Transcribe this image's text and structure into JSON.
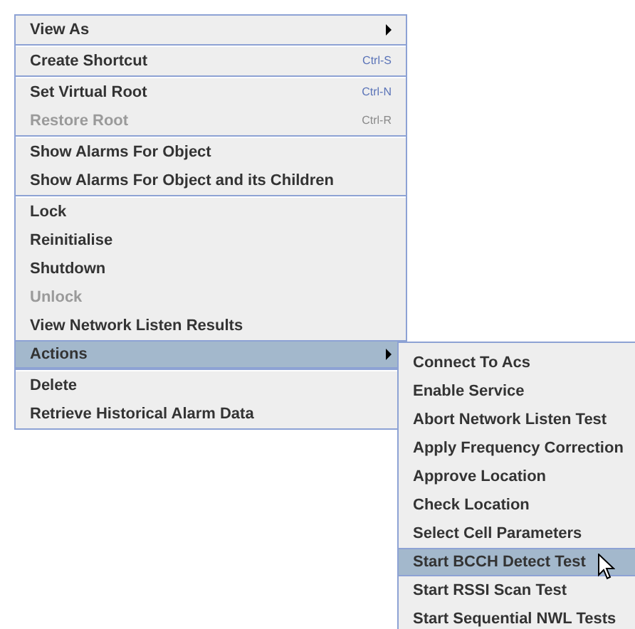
{
  "menu": {
    "groups": [
      {
        "items": [
          {
            "label": "View As",
            "disabled": false,
            "submenu": true,
            "selected": false
          }
        ]
      },
      {
        "items": [
          {
            "label": "Create Shortcut",
            "shortcut": "Ctrl-S",
            "disabled": false,
            "submenu": false,
            "selected": false
          }
        ]
      },
      {
        "items": [
          {
            "label": "Set Virtual Root",
            "shortcut": "Ctrl-N",
            "disabled": false,
            "submenu": false,
            "selected": false
          },
          {
            "label": "Restore Root",
            "shortcut": "Ctrl-R",
            "disabled": true,
            "submenu": false,
            "selected": false
          }
        ]
      },
      {
        "items": [
          {
            "label": "Show Alarms For Object",
            "disabled": false,
            "submenu": false,
            "selected": false
          },
          {
            "label": "Show Alarms For Object and its Children",
            "disabled": false,
            "submenu": false,
            "selected": false
          }
        ]
      },
      {
        "items": [
          {
            "label": "Lock",
            "disabled": false,
            "submenu": false,
            "selected": false
          },
          {
            "label": "Reinitialise",
            "disabled": false,
            "submenu": false,
            "selected": false
          },
          {
            "label": "Shutdown",
            "disabled": false,
            "submenu": false,
            "selected": false
          },
          {
            "label": "Unlock",
            "disabled": true,
            "submenu": false,
            "selected": false
          },
          {
            "label": "View Network Listen Results",
            "disabled": false,
            "submenu": false,
            "selected": false
          },
          {
            "label": "Actions",
            "disabled": false,
            "submenu": true,
            "selected": true
          }
        ]
      },
      {
        "items": [
          {
            "label": "Delete",
            "disabled": false,
            "submenu": false,
            "selected": false
          },
          {
            "label": "Retrieve Historical Alarm Data",
            "disabled": false,
            "submenu": false,
            "selected": false
          }
        ]
      }
    ]
  },
  "submenu": {
    "items": [
      {
        "label": "Connect To Acs",
        "selected": false
      },
      {
        "label": "Enable Service",
        "selected": false
      },
      {
        "label": "Abort Network Listen Test",
        "selected": false
      },
      {
        "label": "Apply Frequency Correction",
        "selected": false
      },
      {
        "label": "Approve Location",
        "selected": false
      },
      {
        "label": "Check Location",
        "selected": false
      },
      {
        "label": "Select Cell Parameters",
        "selected": false
      },
      {
        "label": "Start BCCH Detect Test",
        "selected": true
      },
      {
        "label": "Start RSSI Scan Test",
        "selected": false
      },
      {
        "label": "Start Sequential NWL Tests",
        "selected": false
      }
    ]
  }
}
